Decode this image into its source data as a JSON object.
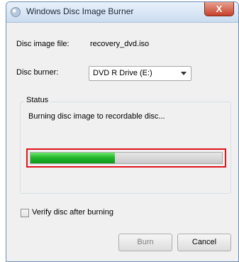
{
  "window": {
    "title": "Windows Disc Image Burner",
    "close_label": "X"
  },
  "disc_image": {
    "label": "Disc image file:",
    "value": "recovery_dvd.iso"
  },
  "disc_burner": {
    "label": "Disc burner:",
    "selected": "DVD R Drive (E:)"
  },
  "status": {
    "group_title": "Status",
    "message": "Burning disc image to recordable disc...",
    "progress_percent": 44
  },
  "verify": {
    "label": "Verify disc after burning",
    "checked": false
  },
  "buttons": {
    "burn": "Burn",
    "cancel": "Cancel"
  },
  "colors": {
    "progress_fill": "#1fb32a",
    "highlight_border": "#e2141c",
    "close_button": "#c6412c"
  }
}
